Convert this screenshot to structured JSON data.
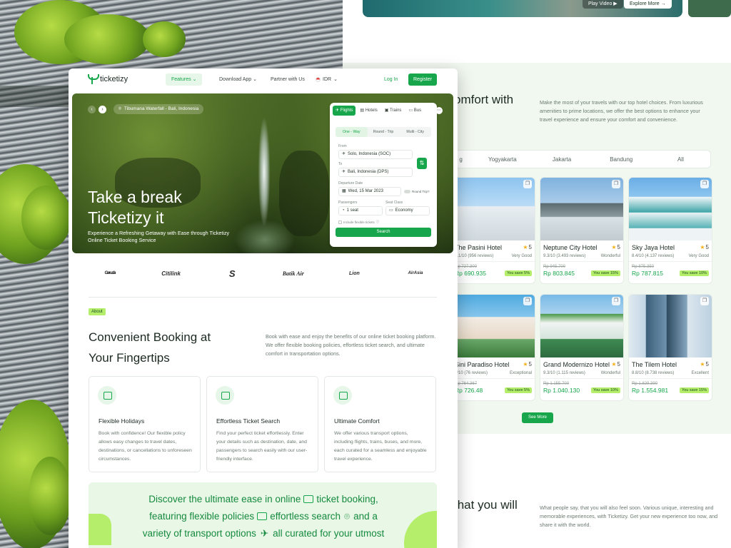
{
  "right_page": {
    "top_buttons": {
      "play": "Play Video ▶",
      "explore": "Explore More →"
    },
    "hotels_heading": "omfort with",
    "hotels_desc": "Make the most of your travels with our top hotel choices. From luxurious amenities to prime locations, we offer the best options to enhance your travel experience and ensure your comfort and convenience.",
    "city_tabs": [
      "g",
      "Yogyakarta",
      "Jakarta",
      "Bandung",
      "All"
    ],
    "hotels": [
      {
        "name": "The Pasini Hotel",
        "rating": "5",
        "score": "4.1/10 (956 reviews)",
        "label": "Very Good",
        "old_price": "Rp 727.300",
        "price": "Rp 690.935",
        "save": "You save 5%"
      },
      {
        "name": "Neptune City Hotel",
        "rating": "5",
        "score": "9.3/10 (3.493 reviews)",
        "label": "Wonderful",
        "old_price": "Rp 945.700",
        "price": "Rp 803.845",
        "save": "You save 15%"
      },
      {
        "name": "Sky Jaya Hotel",
        "rating": "5",
        "score": "8.4/10 (4.137 reviews)",
        "label": "Very Good",
        "old_price": "Rp 875.350",
        "price": "Rp 787.815",
        "save": "You save 10%"
      },
      {
        "name": "Sini Paradiso Hotel",
        "rating": "5",
        "score": "5/10 (76 reviews)",
        "label": "Exceptional",
        "old_price": "Rp 764.367",
        "price": "Rp 726.48",
        "save": "You save 5%"
      },
      {
        "name": "Grand Modernizo Hotel",
        "rating": "5",
        "score": "9.3/10 (1.115 reviews)",
        "label": "Wonderful",
        "old_price": "Rp 1.155.700",
        "price": "Rp 1.040.130",
        "save": "You save 10%"
      },
      {
        "name": "The Tilem Hotel",
        "rating": "5",
        "score": "8.8/10 (8.738 reviews)",
        "label": "Excellent",
        "old_price": "Rp 1.829.390",
        "price": "Rp 1.554.981",
        "save": "You save 15%"
      }
    ],
    "see_more": "See More",
    "testimonials_heading": "that you will",
    "testimonials_desc": "What people say, that you will also feel soon. Various unique, interesting and memorable experiences, with Ticketizy. Get your new experience too now, and share it with the world."
  },
  "nav": {
    "brand": "ticketizy",
    "features": "Features",
    "download": "Download App",
    "partner": "Partner with Us",
    "currency": "IDR",
    "login": "Log In",
    "register": "Register"
  },
  "hero": {
    "location": "Tibumana Waterfall - Bali, Indonesia",
    "title": "Take a break Ticketizy it",
    "subtitle": "Experience a Refreshing Getaway with Ease through Ticketizy Online Ticket Booking Service"
  },
  "booking": {
    "tabs": [
      "Flights",
      "Hotels",
      "Trains",
      "Bus"
    ],
    "trip_types": [
      "One - Way",
      "Round - Trip",
      "Multi - City"
    ],
    "from_label": "From",
    "from_value": "Solo, Indonesia (SOC)",
    "to_label": "To",
    "to_value": "Bali, Indonesia (DPS)",
    "departure_label": "Departure Date",
    "departure_value": "Wed, 15 Mar 2023",
    "round_trip": "Round Trip?",
    "passengers_label": "Passengers",
    "passengers_value": "1 seat",
    "class_label": "Seat Class",
    "class_value": "Economy",
    "flexible": "Include flexible tickets",
    "search": "Search"
  },
  "airlines": [
    "Garuda",
    "Citilink",
    "S",
    "Batik Air",
    "Lion",
    "AirAsia"
  ],
  "about": {
    "badge": "About",
    "title": "Convenient Booking at Your Fingertips",
    "desc": "Book with ease and enjoy the benefits of our online ticket booking platform. We offer flexible booking policies, effortless ticket search, and ultimate comfort in transportation options."
  },
  "features": [
    {
      "title": "Flexible Holidays",
      "desc": "Book with confidence! Our flexible policy allows easy changes to travel dates, destinations, or cancellations to unforeseen circumstances."
    },
    {
      "title": "Effortless Ticket Search",
      "desc": "Find your perfect ticket effortlessly. Enter your details such as destination, date, and passengers to search easily with our user-friendly interface."
    },
    {
      "title": "Ultimate Comfort",
      "desc": "We offer various transport options, including flights, trains, buses, and more, each curated for a seamless and enjoyable travel experience."
    }
  ],
  "discover": {
    "line1a": "Discover the ultimate ease in online",
    "line1b": "ticket booking,",
    "line2a": "featuring flexible policies",
    "line2b": "effortless search",
    "line2c": "and a",
    "line3a": "variety of transport options",
    "line3b": "all curated for your utmost"
  },
  "colors": {
    "accent": "#17a64b",
    "lime": "#b5ee6a",
    "mint": "#e9f7e6"
  }
}
